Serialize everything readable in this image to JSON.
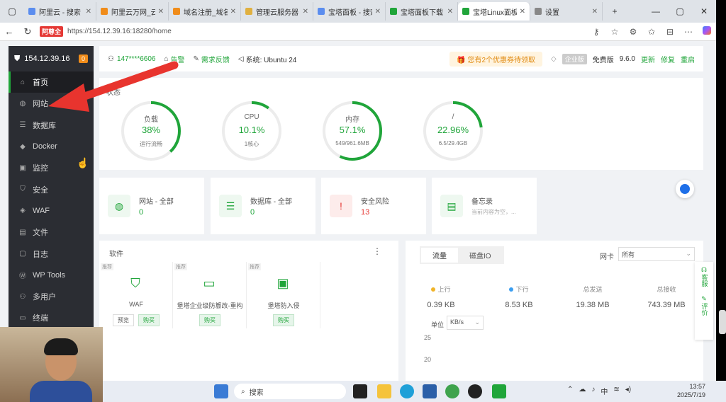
{
  "browser": {
    "tabs": [
      {
        "label": "阿里云 - 搜索",
        "color": "#5b8def",
        "active": false
      },
      {
        "label": "阿里云万网_云",
        "color": "#f08c1a",
        "active": false
      },
      {
        "label": "域名注册_域名",
        "color": "#f08c1a",
        "active": false
      },
      {
        "label": "管理云服务器",
        "color": "#e0b040",
        "active": false
      },
      {
        "label": "宝塔面板 - 搜索",
        "color": "#5b8def",
        "active": false
      },
      {
        "label": "宝塔面板下载",
        "color": "#20a53a",
        "active": false
      },
      {
        "label": "宝塔Linux面板",
        "color": "#20a53a",
        "active": true
      },
      {
        "label": "设置",
        "color": "#888888",
        "active": false
      }
    ],
    "url_badge": "阿尊全",
    "url": "https://154.12.39.16:18280/home"
  },
  "sidebar": {
    "ip": "154.12.39.16",
    "badge": "0",
    "items": [
      {
        "label": "首页",
        "icon": "home-icon",
        "active": true
      },
      {
        "label": "网站",
        "icon": "globe-icon",
        "active": false
      },
      {
        "label": "数据库",
        "icon": "database-icon",
        "active": false
      },
      {
        "label": "Docker",
        "icon": "docker-icon",
        "active": false
      },
      {
        "label": "监控",
        "icon": "monitor-icon",
        "active": false
      },
      {
        "label": "安全",
        "icon": "shield-icon",
        "active": false
      },
      {
        "label": "WAF",
        "icon": "waf-icon",
        "active": false
      },
      {
        "label": "文件",
        "icon": "folder-icon",
        "active": false
      },
      {
        "label": "日志",
        "icon": "log-icon",
        "active": false
      },
      {
        "label": "WP Tools",
        "icon": "wordpress-icon",
        "active": false
      },
      {
        "label": "多用户",
        "icon": "users-icon",
        "active": false
      },
      {
        "label": "终端",
        "icon": "terminal-icon",
        "active": false
      }
    ]
  },
  "topbar": {
    "user": "147****6606",
    "items": [
      "告警",
      "需求反馈"
    ],
    "system": "系统: Ubuntu 24",
    "coupon": "您有2个优惠券待领取",
    "edition": "企业版",
    "free": "免费版",
    "version": "9.6.0",
    "links": [
      "更新",
      "修复",
      "重启"
    ]
  },
  "status": {
    "title": "状态",
    "gauges": [
      {
        "title": "负载",
        "value": "38%",
        "sub": "运行流畅",
        "pct": 0.38
      },
      {
        "title": "CPU",
        "value": "10.1%",
        "sub": "1核心",
        "pct": 0.101
      },
      {
        "title": "内存",
        "value": "57.1%",
        "sub": "549/961.6MB",
        "pct": 0.571
      },
      {
        "title": "/",
        "value": "22.96%",
        "sub": "6.5/29.4GB",
        "pct": 0.2296
      }
    ]
  },
  "cards": [
    {
      "title": "网站 - 全部",
      "value": "0",
      "icon": "globe-icon"
    },
    {
      "title": "数据库 - 全部",
      "value": "0",
      "icon": "database-icon"
    },
    {
      "title": "安全风险",
      "value": "13",
      "icon": "shield-alert-icon"
    },
    {
      "title": "备忘录",
      "value": "当前内容为空，...",
      "icon": "memo-icon"
    }
  ],
  "software": {
    "title": "软件",
    "items": [
      {
        "tag": "推荐",
        "name": "WAF",
        "buttons": [
          "预览",
          "购买"
        ]
      },
      {
        "tag": "推荐",
        "name": "堡塔企业级防篡改-重构",
        "buttons": [
          "购买"
        ]
      },
      {
        "tag": "推荐",
        "name": "堡塔防入侵",
        "buttons": [
          "购买"
        ]
      }
    ]
  },
  "traffic": {
    "tabs": [
      "流量",
      "磁盘IO"
    ],
    "nic_label": "网卡",
    "nic_value": "所有",
    "stats": [
      {
        "label": "上行",
        "value": "0.39 KB",
        "dot": "#f0b429"
      },
      {
        "label": "下行",
        "value": "8.53 KB",
        "dot": "#3b9ef0"
      },
      {
        "label": "总发送",
        "value": "19.38 MB",
        "dot": ""
      },
      {
        "label": "总接收",
        "value": "743.39 MB",
        "dot": ""
      }
    ],
    "unit_label": "单位",
    "unit_value": "KB/s",
    "yticks": [
      "25",
      "20"
    ]
  },
  "side_tools": [
    {
      "label": "客服"
    },
    {
      "label": "评价"
    }
  ],
  "taskbar": {
    "search": "搜索",
    "time": "13:57",
    "date": "2025/7/19",
    "ime": "中"
  },
  "colors": {
    "accent": "#20a53a",
    "danger": "#e53935",
    "sidebar": "#2b2d33"
  }
}
